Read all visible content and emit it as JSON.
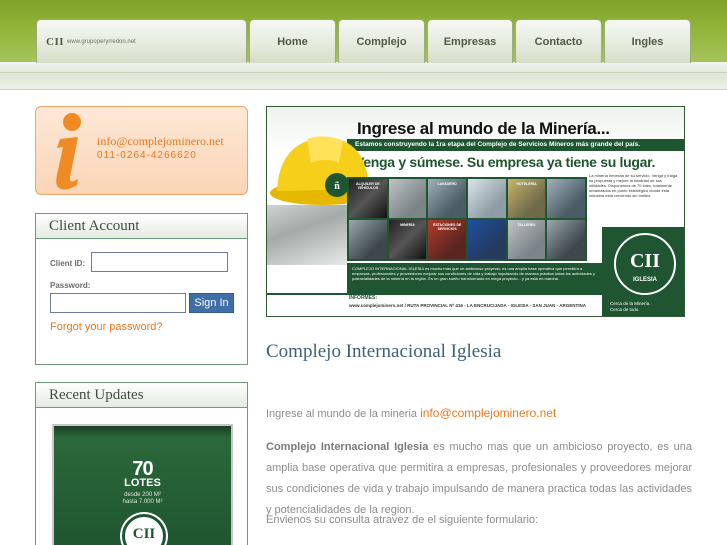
{
  "header": {
    "logo_mark": "CII",
    "logo_url": "www.grupoperyrredon.net",
    "nav": [
      {
        "label": "Home"
      },
      {
        "label": "Complejo"
      },
      {
        "label": "Empresas"
      },
      {
        "label": "Contacto"
      },
      {
        "label": "Ingles"
      }
    ]
  },
  "contact": {
    "email": "info@complejominero.net",
    "phone": "011-0264-4266620",
    "icon": "info-icon",
    "accent": "#e8781d"
  },
  "client_account": {
    "title": "Client Account",
    "client_id_label": "Client ID:",
    "password_label": "Password:",
    "client_id_value": "",
    "password_value": "",
    "signin_label": "Sign In",
    "forgot_label": "Forgot your password?"
  },
  "recent_updates": {
    "title": "Recent Updates",
    "card": {
      "number": "70",
      "word": "LOTES",
      "sub1": "desde  200  M²",
      "sub2": "hasta  7.000  M²",
      "logo": "CII"
    }
  },
  "banner": {
    "title": "Ingrese al mundo de la Minería...",
    "strip": "Estamos construyendo la 1ra etapa del Complejo de Servicios Mineros más grande del país.",
    "slogan": "Venga y súmese. Su empresa ya tiene su lugar.",
    "side_text": "La minería necesita de su servicio. Venga y traiga su propuesta y mejore la totalidad de sus utilidades. Disponemos de 70 lotes, totalmente urbanizados en punto estratégico donde esta industria está creciendo sin límites.",
    "tiles": [
      "ALQUILER DE VEHÍCULOS",
      "",
      "LAVADERO",
      "",
      "HOTELERÍA",
      "",
      "",
      "MINERÍA",
      "ESTACIONES DE SERVICIOS",
      "",
      "TALLERES",
      ""
    ],
    "bottom_text": "COMPLEJO INTERNACIONAL IGLESIA es mucho más que un ambicioso proyecto, es una amplia base operativa que permitirá a empresas, profesionales y proveedores mejorar sus condiciones de vida y trabajo impulsando de manera práctica todas las actividades y potencialidades de la minería en la región. Es un gran sueño transformado en mega proyecto... y ya está en marcha.",
    "informes_label": "INFORMES:",
    "informes_text": "www.complejominero.net / RUTA PROVINCIAL Nº 416 - LA ENCRUCIJADA - IGLESIA - SAN JUAN - ARGENTINA",
    "seal_ci": "CII",
    "seal_name": "IGLESIA",
    "seal_line1": "Cerca de la Minería.",
    "seal_line2": "Cerca de todo."
  },
  "main": {
    "title": "Complejo Internacional Iglesia",
    "intro_text": "Ingrese al mundo de la mineria",
    "intro_email": "info@complejominero.net",
    "para_bold": "Complejo Internacional Iglesia",
    "para_text": " es mucho mas que un ambicioso proyecto, es una amplia base operativa que permitira a empresas, profesionales y proveedores mejorar sus condiciones de vida y trabajo impulsando de manera practica todas las actividades y potencialidades de la region.",
    "para2": "Envienos su consulta atravez de el siguiente formulario:"
  },
  "colors": {
    "header_green": "#8fb236",
    "panel_border": "#6f9a7b",
    "title_blue": "#3f5f7c",
    "button_blue": "#3f6fa6",
    "brand_green": "#1f5530"
  }
}
